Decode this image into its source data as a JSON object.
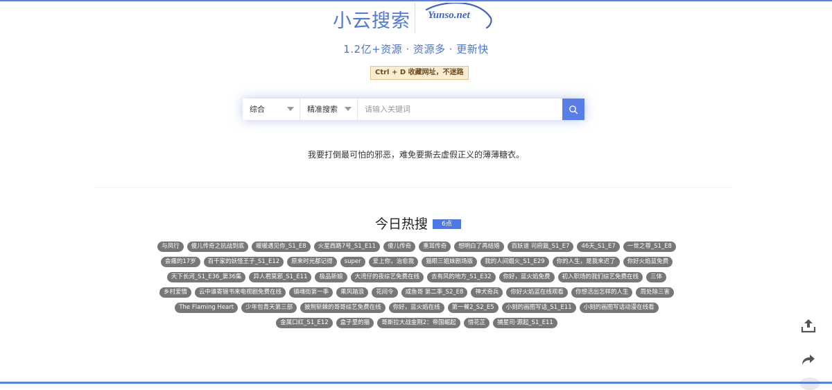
{
  "brand": {
    "name": "小云搜索",
    "domain": "Yunso.net",
    "accent_color": "#4f78d8"
  },
  "tagline": "1.2亿+资源 · 资源多 · 更新快",
  "tip": "Ctrl + D 收藏网址，不迷路",
  "search": {
    "category_selected": "综合",
    "mode_selected": "精准搜索",
    "placeholder": "请输入关键词",
    "button_icon": "search-icon",
    "button_color": "#5a7ee8"
  },
  "quote": "我要打倒最可怕的邪恶，难免要撕去虚假正义的薄薄糖衣。",
  "hot": {
    "title": "今日热搜",
    "time_badge": "6点",
    "tags": [
      "与凤行",
      "傻儿传奇之抗战到底",
      "暖暖遇见你_S1_E8",
      "火星西路7号_S1_E11",
      "傻儿传奇",
      "重耳传奇",
      "想明白了再结婚",
      "百妖谱 司府篇_S1_E7",
      "46天_S1_E7",
      "一世之尊_S1_E8",
      "会痛的17岁",
      "百千家的妖怪王子_S1_E12",
      "原来时光都记得",
      "super",
      "爱上你，治愈我",
      "猫眼三姐妹剧场版",
      "我的人间烟火_S1_E29",
      "你的人生，是我来迟了",
      "你好火焰蓝免费",
      "天下长河_S1_E36_第36集",
      "异人君莫邪_S1_E11",
      "极品新娘",
      "大湾仔的夜综艺免费在线",
      "去有风的地方_S1_E32",
      "你好，蓝火焰免费",
      "初入职场的我们综艺免费在线",
      "三体",
      "乡村爱情",
      "云中谁寄锦书来电视剧免费在线",
      "镇魂街第一季",
      "乘风踏浪",
      "花间令",
      "咸鱼哥 第二季_S2_E8",
      "神犬奇兵",
      "你好火焰蓝在线观看",
      "你想活出怎样的人生",
      "周处除三害",
      "The Flaming Heart",
      "少年包青天第三部",
      "披荆斩棘的哥哥综艺免费在线",
      "你好，蓝火焰在线",
      "第一餐2_S2_E5",
      "小刻的画图写话_S1_E11",
      "小刻的画图写话动漫在线看",
      "金属口红_S1_E12",
      "盒子里的猫",
      "哥斯拉大战金刚2：帝国崛起",
      "惜花芷",
      "捕星司·源起_S1_E11"
    ]
  },
  "side_tools": {
    "upload_icon": "upload-icon",
    "share_icon": "share-icon"
  }
}
